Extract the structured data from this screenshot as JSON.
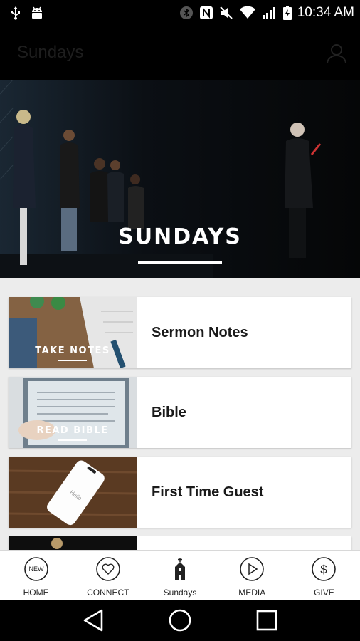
{
  "status_bar": {
    "time": "10:34 AM",
    "icons": [
      "usb-icon",
      "android-icon",
      "bluetooth-icon",
      "nfc-icon",
      "mute-icon",
      "wifi-icon",
      "signal-icon",
      "battery-icon"
    ]
  },
  "app_bar": {
    "title": "Sundays",
    "profile_icon": "person-icon"
  },
  "hero": {
    "title": "SUNDAYS"
  },
  "items": [
    {
      "label": "Sermon Notes",
      "thumb_caption": "TAKE NOTES"
    },
    {
      "label": "Bible",
      "thumb_caption": "READ BIBLE"
    },
    {
      "label": "First Time Guest",
      "thumb_caption": "",
      "thumb_phone_text": "Hello"
    },
    {
      "label": "",
      "thumb_caption": ""
    }
  ],
  "bottom_nav": [
    {
      "label": "HOME",
      "icon": "new-badge-icon",
      "badge": "NEW"
    },
    {
      "label": "CONNECT",
      "icon": "heart-icon"
    },
    {
      "label": "Sundays",
      "icon": "church-icon",
      "active": true
    },
    {
      "label": "MEDIA",
      "icon": "play-icon"
    },
    {
      "label": "GIVE",
      "icon": "dollar-icon"
    }
  ],
  "system_nav": [
    "back-icon",
    "home-icon",
    "recents-icon"
  ],
  "colors": {
    "background": "#000000",
    "list_background": "#ececec",
    "card": "#ffffff",
    "text": "#1a1a1a"
  }
}
